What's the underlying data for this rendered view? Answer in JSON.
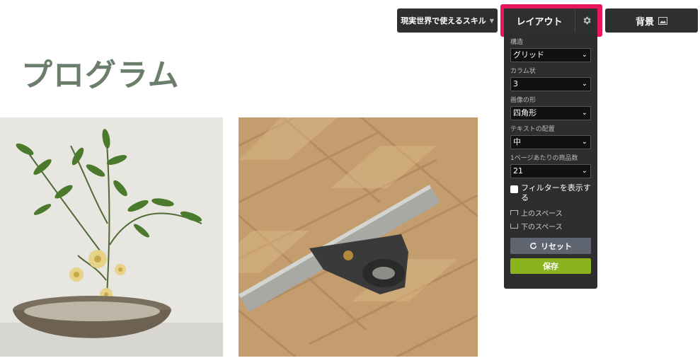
{
  "header": {
    "title": "プログラム"
  },
  "toolbar": {
    "category_label": "現実世界で使えるスキル",
    "layout_label": "レイアウト",
    "background_label": "背景"
  },
  "panel": {
    "structure": {
      "label": "構造",
      "value": "グリッド"
    },
    "columns": {
      "label": "カラム状",
      "value": "3"
    },
    "image_shape": {
      "label": "画像の形",
      "value": "四角形"
    },
    "text_align": {
      "label": "テキストの配置",
      "value": "中"
    },
    "per_page": {
      "label": "1ページあたりの商品数",
      "value": "21"
    },
    "show_filter_label": "フィルターを表示する",
    "top_space_label": "上のスペース",
    "bottom_space_label": "下のスペース",
    "reset_label": "リセット",
    "save_label": "保存"
  },
  "colors": {
    "title": "#6b7d6b",
    "highlight": "#e8175d",
    "panel_bg": "#2e2e2e",
    "save": "#8ab31d",
    "reset": "#5e6570"
  },
  "icons": {
    "gear": "gear-icon",
    "image": "image-icon",
    "refresh": "refresh-icon",
    "caret": "chevron-down-icon"
  }
}
